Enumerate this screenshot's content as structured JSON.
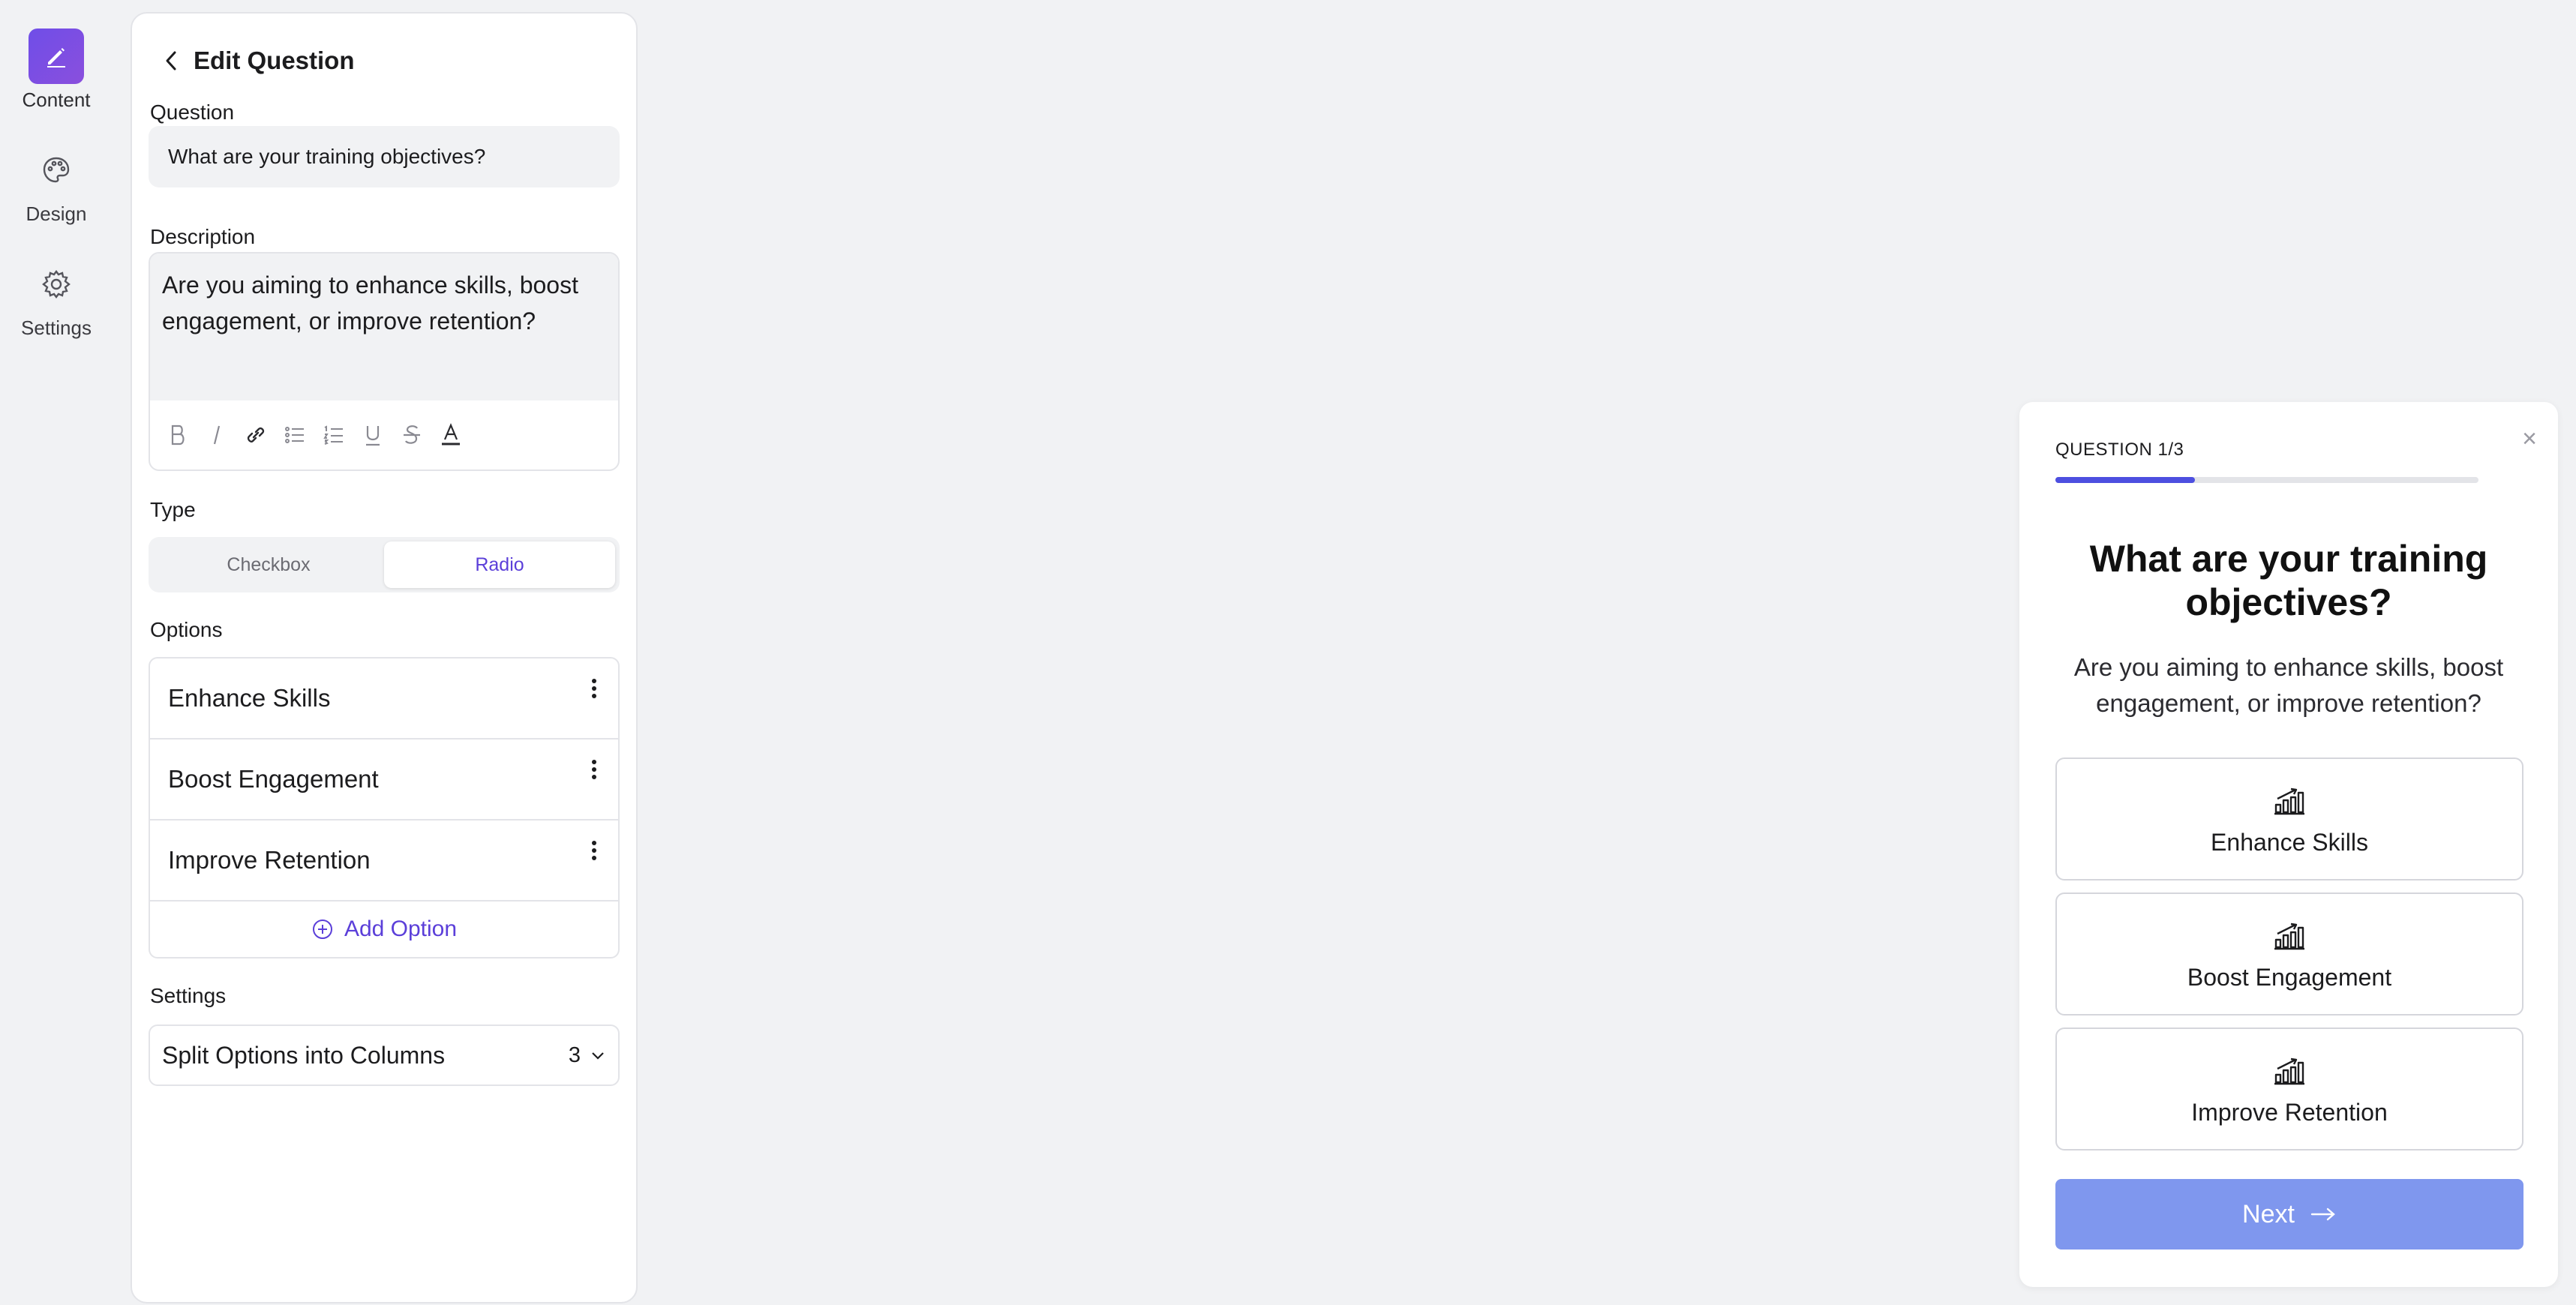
{
  "rail": {
    "items": [
      {
        "label": "Content",
        "icon": "pencil-icon",
        "active": true
      },
      {
        "label": "Design",
        "icon": "palette-icon",
        "active": false
      },
      {
        "label": "Settings",
        "icon": "gear-icon",
        "active": false
      }
    ]
  },
  "editor": {
    "title": "Edit Question",
    "question_label": "Question",
    "question_value": "What are your training objectives?",
    "description_label": "Description",
    "description_value": "Are you aiming to enhance skills, boost engagement, or improve retention?",
    "toolbar": [
      "bold-icon",
      "italic-icon",
      "link-icon",
      "bullet-list-icon",
      "numbered-list-icon",
      "underline-icon",
      "strikethrough-icon",
      "text-color-icon"
    ],
    "type_label": "Type",
    "type_options": [
      "Checkbox",
      "Radio"
    ],
    "type_selected": "Radio",
    "options_label": "Options",
    "options": [
      "Enhance Skills",
      "Boost Engagement",
      "Improve Retention"
    ],
    "add_option_label": "Add Option",
    "settings_label": "Settings",
    "columns_label": "Split Options into Columns",
    "columns_value": "3"
  },
  "preview": {
    "step_label": "QUESTION 1/3",
    "progress": 0.33,
    "title": "What are your training objectives?",
    "description": "Are you aiming to enhance skills, boost engagement, or improve retention?",
    "options": [
      "Enhance Skills",
      "Boost Engagement",
      "Improve Retention"
    ],
    "option_icon": "bar-chart-growth-icon",
    "next_label": "Next",
    "close_icon": "×"
  },
  "colors": {
    "accent": "#5b3fd9",
    "progress": "#4d4fe0",
    "next_button": "#7f97ee",
    "background": "#f1f2f4"
  }
}
